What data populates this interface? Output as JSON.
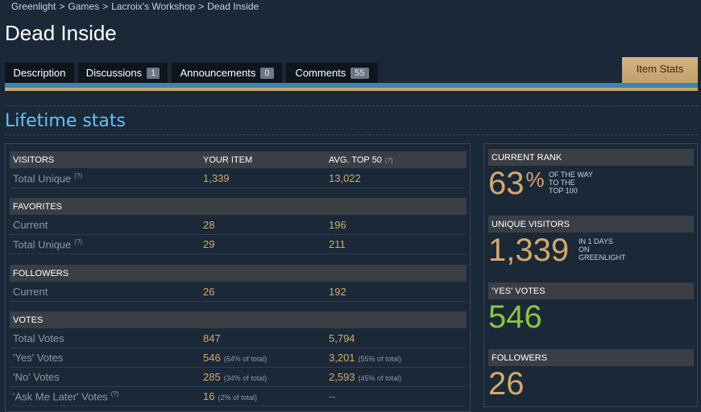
{
  "breadcrumb": {
    "items": [
      "Greenlight",
      "Games",
      "Lacroix's Workshop",
      "Dead Inside"
    ],
    "sep": ">"
  },
  "title": "Dead Inside",
  "tabs": [
    {
      "label": "Description"
    },
    {
      "label": "Discussions",
      "count": "1"
    },
    {
      "label": "Announcements",
      "count": "0"
    },
    {
      "label": "Comments",
      "count": "55"
    }
  ],
  "active_tab": "Item Stats",
  "section_title": "Lifetime stats",
  "stats": {
    "visitors": {
      "header": [
        "VISITORS",
        "YOUR ITEM",
        "AVG. TOP 50"
      ],
      "header_q": "(?)",
      "rows": [
        {
          "label": "Total Unique",
          "q": "(?)",
          "yours": "1,339",
          "avg": "13,022"
        }
      ]
    },
    "favorites": {
      "header": "FAVORITES",
      "rows": [
        {
          "label": "Current",
          "yours": "28",
          "avg": "196"
        },
        {
          "label": "Total Unique",
          "q": "(?)",
          "yours": "29",
          "avg": "211"
        }
      ]
    },
    "followers": {
      "header": "FOLLOWERS",
      "rows": [
        {
          "label": "Current",
          "yours": "26",
          "avg": "192"
        }
      ]
    },
    "votes": {
      "header": "VOTES",
      "rows": [
        {
          "label": "Total Votes",
          "yours": "847",
          "avg": "5,794"
        },
        {
          "label": "'Yes' Votes",
          "yours": "546",
          "yours_pct": "(64% of total)",
          "avg": "3,201",
          "avg_pct": "(55% of total)"
        },
        {
          "label": "'No' Votes",
          "yours": "285",
          "yours_pct": "(34% of total)",
          "avg": "2,593",
          "avg_pct": "(45% of total)"
        },
        {
          "label": "'Ask Me Later' Votes",
          "q": "(?)",
          "yours": "16",
          "yours_pct": "(2% of total)",
          "avg": "--"
        }
      ]
    }
  },
  "side": {
    "rank": {
      "header": "CURRENT RANK",
      "value": "63",
      "unit": "%",
      "note": [
        "OF THE WAY",
        "TO THE",
        "TOP 100"
      ]
    },
    "visitors": {
      "header": "UNIQUE VISITORS",
      "value": "1,339",
      "note": [
        "IN 1 DAYS",
        "ON",
        "GREENLIGHT"
      ]
    },
    "yes": {
      "header": "'YES' VOTES",
      "value": "546"
    },
    "followers": {
      "header": "FOLLOWERS",
      "value": "26"
    }
  },
  "colors": {
    "accent": "#66c0f4",
    "gold": "#d2a96a",
    "green": "#8bc53f",
    "bg": "#1b2838"
  }
}
